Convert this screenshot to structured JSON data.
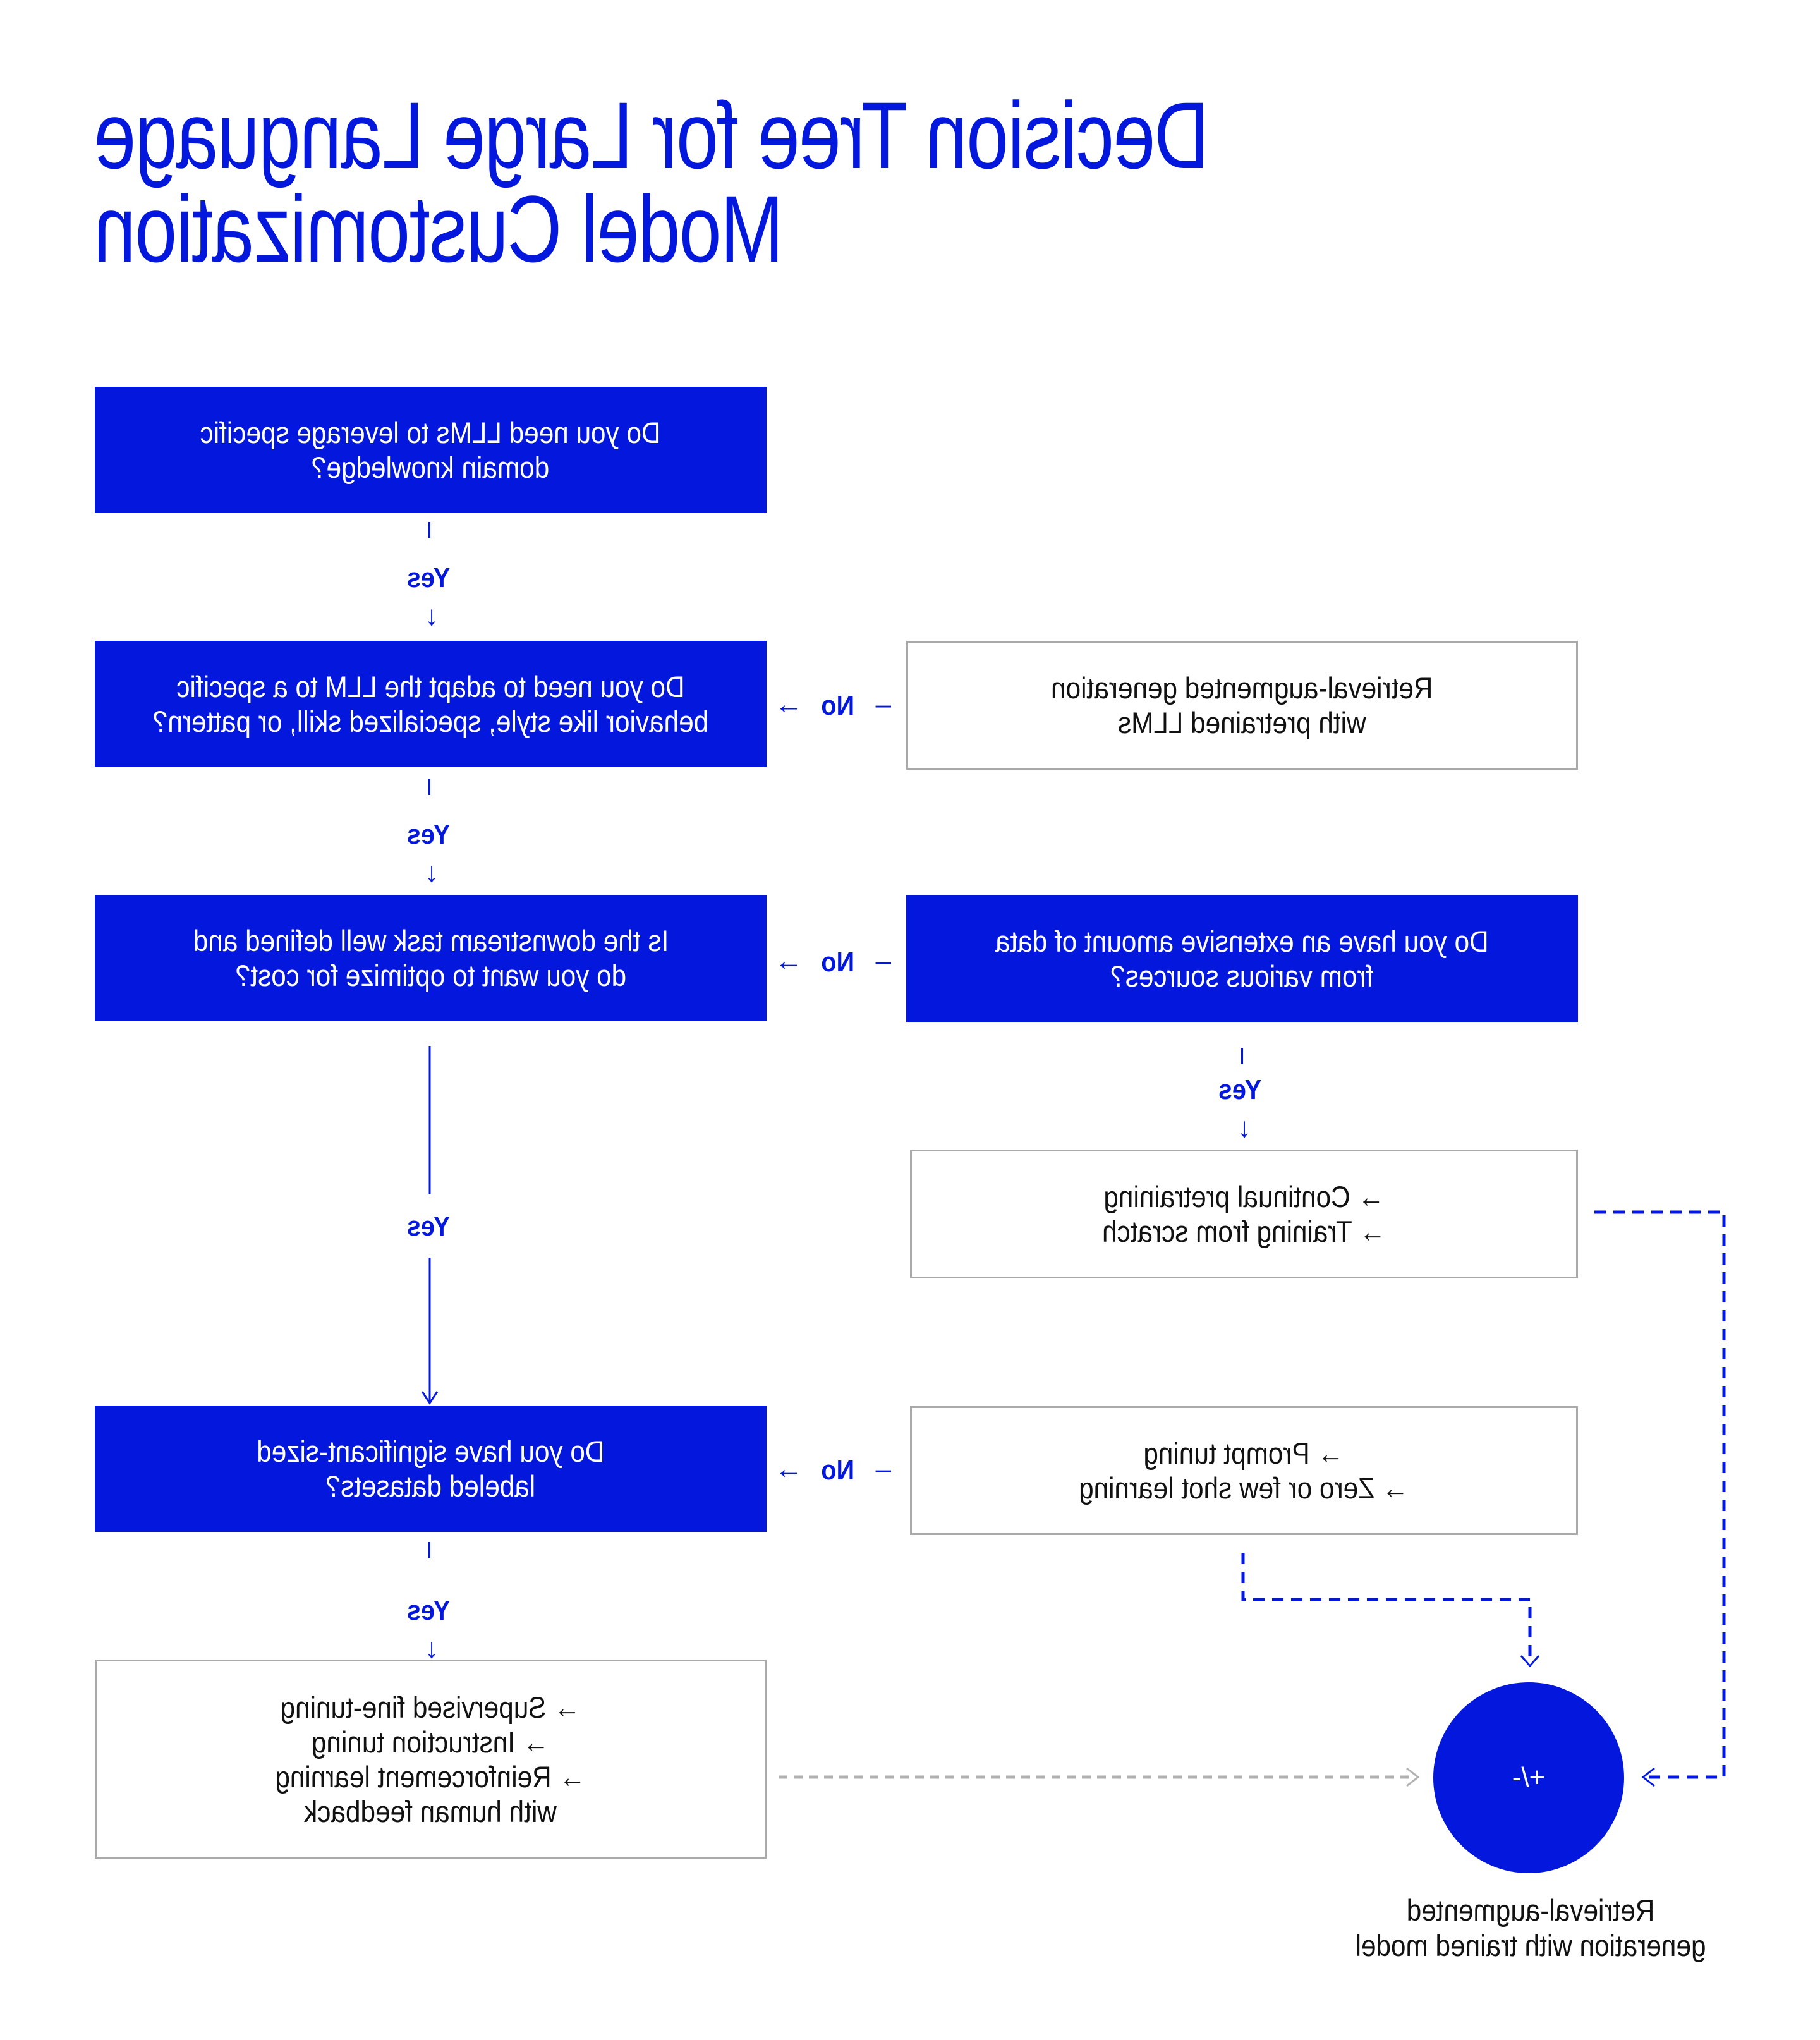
{
  "title": {
    "line1": "Decision Tree for Large Language",
    "line2": "Model Customization"
  },
  "colors": {
    "accent": "#0318dc",
    "question_text": "#ffffff",
    "answer_text": "#111111",
    "answer_border": "#a9a9a9",
    "grey_connector": "#b0b0b0"
  },
  "nodes": {
    "q1": {
      "lines": [
        "Do you need LLMs to leverage specific",
        "domain knowledge?"
      ]
    },
    "q2": {
      "lines": [
        "Do you need to adapt the LLM to a specific",
        "behavior like style, specialized skill, or pattern?"
      ]
    },
    "q3": {
      "lines": [
        "Is the downstream task well defined and",
        "do you want to optimize for cost?"
      ]
    },
    "q4": {
      "lines": [
        "Do you have significant-sized",
        "labeled datasets?"
      ]
    },
    "q5": {
      "lines": [
        "Do you have an extensive amount of data",
        "from various sources?"
      ]
    },
    "a_rag_pretrained": {
      "lines": [
        "Retrieval-augmented generation",
        "with pretrained LLMs"
      ]
    },
    "a_pretraining": {
      "lines": [
        "→ Continual pretraining",
        "→ Training from scratch"
      ]
    },
    "a_prompt": {
      "lines": [
        "→ Prompt tuning",
        "→ Zero or few shot learning"
      ]
    },
    "a_finetune": {
      "lines": [
        "→ Supervised fine-tuning",
        "→ Instruction tuning",
        "→ Reinforcement learning",
        "with human feedback"
      ]
    }
  },
  "edges": {
    "yes_label": "Yes",
    "no_label": "No",
    "arrow_down": "↓",
    "arrow_right": "→",
    "dash": "–"
  },
  "combine": {
    "symbol": "+/-",
    "label_lines": [
      "Retrieval-augmented",
      "generation with trained model"
    ]
  }
}
